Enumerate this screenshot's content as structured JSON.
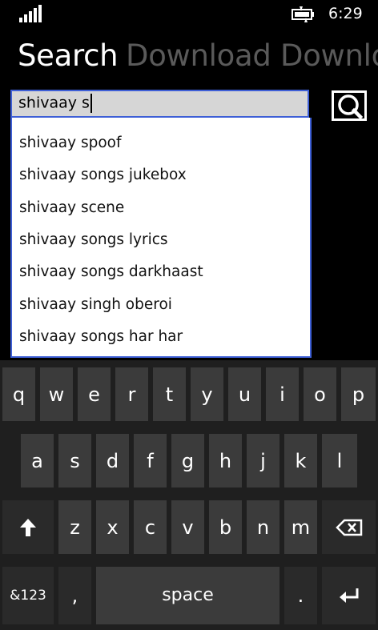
{
  "status_bar": {
    "time": "6:29",
    "signal_icon": "signal-bars-icon",
    "battery_icon": "battery-charging-icon"
  },
  "pivot": {
    "items": [
      "Search",
      "Download",
      "Downlo"
    ]
  },
  "search": {
    "value": "shivaay s",
    "button_icon": "magnifier-icon"
  },
  "suggestions": [
    "shivaay spoof",
    "shivaay songs jukebox",
    "shivaay scene",
    "shivaay songs lyrics",
    "shivaay songs darkhaast",
    "shivaay singh oberoi",
    "shivaay songs har har"
  ],
  "keyboard": {
    "row1": [
      "q",
      "w",
      "e",
      "r",
      "t",
      "y",
      "u",
      "i",
      "o",
      "p"
    ],
    "row2": [
      "a",
      "s",
      "d",
      "f",
      "g",
      "h",
      "j",
      "k",
      "l"
    ],
    "row3": [
      "z",
      "x",
      "c",
      "v",
      "b",
      "n",
      "m"
    ],
    "symbols_label": "&123",
    "comma_label": ",",
    "space_label": "space",
    "period_label": ".",
    "shift_icon": "shift-arrow-icon",
    "backspace_icon": "backspace-icon",
    "enter_icon": "enter-icon"
  },
  "colors": {
    "accent": "#3e5fd6",
    "background": "#000000",
    "key": "#3b3b3b",
    "key_dark": "#2a2a2a"
  }
}
